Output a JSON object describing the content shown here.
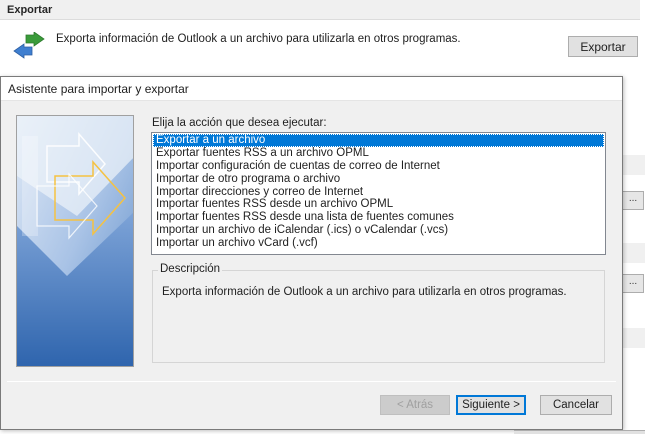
{
  "background": {
    "section_title": "Exportar",
    "description": "Exporta información de Outlook a un archivo para utilizarla en otros programas.",
    "export_button": "Exportar",
    "dots_label": "..."
  },
  "dialog": {
    "title": "Asistente para importar y exportar",
    "prompt": "Elija la acción que desea ejecutar:",
    "actions": [
      "Exportar a un archivo",
      "Exportar fuentes RSS a un archivo OPML",
      "Importar configuración de cuentas de correo de Internet",
      "Importar de otro programa o archivo",
      "Importar direcciones y correo de Internet",
      "Importar fuentes RSS desde un archivo OPML",
      "Importar fuentes RSS desde una lista de fuentes comunes",
      "Importar un archivo de iCalendar (.ics) o vCalendar (.vcs)",
      "Importar un archivo vCard (.vcf)"
    ],
    "selected_index": 0,
    "description_label": "Descripción",
    "description_text": "Exporta información de Outlook a un archivo para utilizarla en otros programas.",
    "buttons": {
      "back": "< Atrás",
      "next": "Siguiente >",
      "cancel": "Cancelar"
    }
  },
  "colors": {
    "selection": "#0078d7",
    "dialog_bg": "#f0f0f0",
    "art_blue": "#5a8ac6"
  },
  "icons": [
    "export-arrows-icon",
    "wizard-art-image"
  ]
}
